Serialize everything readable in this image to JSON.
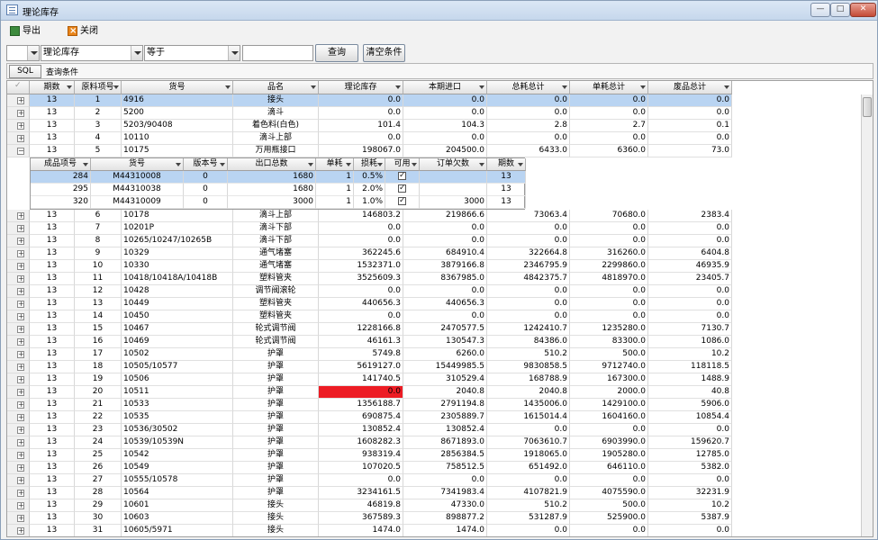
{
  "window": {
    "title": "理论库存",
    "min": "—",
    "max": "□",
    "close": "✕"
  },
  "toolbar": {
    "export": "导出",
    "close": "关闭"
  },
  "filter": {
    "field0": "",
    "field": "理论库存",
    "operator": "等于",
    "value": "",
    "query": "查询",
    "clear": "清空条件"
  },
  "sqlbar": {
    "sql": "SQL",
    "conditions": "查询条件"
  },
  "colors": {
    "negative": "#ed1c24",
    "selected": "#b9d4f2"
  },
  "grid": {
    "headers": [
      "期数",
      "原料项号",
      "货号",
      "品名",
      "理论库存",
      "本期进口",
      "总耗总计",
      "单耗总计",
      "废品总计"
    ],
    "rows": [
      {
        "exp": "+",
        "c": [
          "13",
          "1",
          "4916",
          "接头",
          "0.0",
          "0.0",
          "0.0",
          "0.0",
          "0.0"
        ]
      },
      {
        "exp": "+",
        "c": [
          "13",
          "2",
          "5200",
          "滴斗",
          "0.0",
          "0.0",
          "0.0",
          "0.0",
          "0.0"
        ]
      },
      {
        "exp": "+",
        "c": [
          "13",
          "3",
          "5203/90408",
          "着色料(白色)",
          "101.4",
          "104.3",
          "2.8",
          "2.7",
          "0.1"
        ]
      },
      {
        "exp": "+",
        "c": [
          "13",
          "4",
          "10110",
          "滴斗上部",
          "0.0",
          "0.0",
          "0.0",
          "0.0",
          "0.0"
        ]
      },
      {
        "exp": "−",
        "c": [
          "13",
          "5",
          "10175",
          "万用瓶接口",
          "198067.0",
          "204500.0",
          "6433.0",
          "6360.0",
          "73.0"
        ]
      },
      {
        "exp": "+",
        "c": [
          "13",
          "6",
          "10178",
          "滴斗上部",
          "146803.2",
          "219866.6",
          "73063.4",
          "70680.0",
          "2383.4"
        ]
      },
      {
        "exp": "+",
        "c": [
          "13",
          "7",
          "10201P",
          "滴斗下部",
          "0.0",
          "0.0",
          "0.0",
          "0.0",
          "0.0"
        ]
      },
      {
        "exp": "+",
        "c": [
          "13",
          "8",
          "10265/10247/10265B",
          "滴斗下部",
          "0.0",
          "0.0",
          "0.0",
          "0.0",
          "0.0"
        ]
      },
      {
        "exp": "+",
        "c": [
          "13",
          "9",
          "10329",
          "通气堵塞",
          "362245.6",
          "684910.4",
          "322664.8",
          "316260.0",
          "6404.8"
        ]
      },
      {
        "exp": "+",
        "c": [
          "13",
          "10",
          "10330",
          "通气堵塞",
          "1532371.0",
          "3879166.8",
          "2346795.9",
          "2299860.0",
          "46935.9"
        ]
      },
      {
        "exp": "+",
        "c": [
          "13",
          "11",
          "10418/10418A/10418B",
          "塑料管夹",
          "3525609.3",
          "8367985.0",
          "4842375.7",
          "4818970.0",
          "23405.7"
        ]
      },
      {
        "exp": "+",
        "c": [
          "13",
          "12",
          "10428",
          "调节阀滚轮",
          "0.0",
          "0.0",
          "0.0",
          "0.0",
          "0.0"
        ]
      },
      {
        "exp": "+",
        "c": [
          "13",
          "13",
          "10449",
          "塑料管夹",
          "440656.3",
          "440656.3",
          "0.0",
          "0.0",
          "0.0"
        ]
      },
      {
        "exp": "+",
        "c": [
          "13",
          "14",
          "10450",
          "塑料管夹",
          "0.0",
          "0.0",
          "0.0",
          "0.0",
          "0.0"
        ]
      },
      {
        "exp": "+",
        "c": [
          "13",
          "15",
          "10467",
          "轮式调节阀",
          "1228166.8",
          "2470577.5",
          "1242410.7",
          "1235280.0",
          "7130.7"
        ]
      },
      {
        "exp": "+",
        "c": [
          "13",
          "16",
          "10469",
          "轮式调节阀",
          "46161.3",
          "130547.3",
          "84386.0",
          "83300.0",
          "1086.0"
        ]
      },
      {
        "exp": "+",
        "c": [
          "13",
          "17",
          "10502",
          "护罩",
          "5749.8",
          "6260.0",
          "510.2",
          "500.0",
          "10.2"
        ]
      },
      {
        "exp": "+",
        "c": [
          "13",
          "18",
          "10505/10577",
          "护罩",
          "5619127.0",
          "15449985.5",
          "9830858.5",
          "9712740.0",
          "118118.5"
        ]
      },
      {
        "exp": "+",
        "c": [
          "13",
          "19",
          "10506",
          "护罩",
          "141740.5",
          "310529.4",
          "168788.9",
          "167300.0",
          "1488.9"
        ]
      },
      {
        "exp": "+",
        "c": [
          "13",
          "20",
          "10511",
          "护罩",
          "0.0",
          "2040.8",
          "2040.8",
          "2000.0",
          "40.8"
        ],
        "neg": true
      },
      {
        "exp": "+",
        "c": [
          "13",
          "21",
          "10533",
          "护罩",
          "1356188.7",
          "2791194.8",
          "1435006.0",
          "1429100.0",
          "5906.0"
        ]
      },
      {
        "exp": "+",
        "c": [
          "13",
          "22",
          "10535",
          "护罩",
          "690875.4",
          "2305889.7",
          "1615014.4",
          "1604160.0",
          "10854.4"
        ]
      },
      {
        "exp": "+",
        "c": [
          "13",
          "23",
          "10536/30502",
          "护罩",
          "130852.4",
          "130852.4",
          "0.0",
          "0.0",
          "0.0"
        ]
      },
      {
        "exp": "+",
        "c": [
          "13",
          "24",
          "10539/10539N",
          "护罩",
          "1608282.3",
          "8671893.0",
          "7063610.7",
          "6903990.0",
          "159620.7"
        ]
      },
      {
        "exp": "+",
        "c": [
          "13",
          "25",
          "10542",
          "护罩",
          "938319.4",
          "2856384.5",
          "1918065.0",
          "1905280.0",
          "12785.0"
        ]
      },
      {
        "exp": "+",
        "c": [
          "13",
          "26",
          "10549",
          "护罩",
          "107020.5",
          "758512.5",
          "651492.0",
          "646110.0",
          "5382.0"
        ]
      },
      {
        "exp": "+",
        "c": [
          "13",
          "27",
          "10555/10578",
          "护罩",
          "0.0",
          "0.0",
          "0.0",
          "0.0",
          "0.0"
        ]
      },
      {
        "exp": "+",
        "c": [
          "13",
          "28",
          "10564",
          "护罩",
          "3234161.5",
          "7341983.4",
          "4107821.9",
          "4075590.0",
          "32231.9"
        ]
      },
      {
        "exp": "+",
        "c": [
          "13",
          "29",
          "10601",
          "接头",
          "46819.8",
          "47330.0",
          "510.2",
          "500.0",
          "10.2"
        ]
      },
      {
        "exp": "+",
        "c": [
          "13",
          "30",
          "10603",
          "接头",
          "367589.3",
          "898877.2",
          "531287.9",
          "525900.0",
          "5387.9"
        ]
      },
      {
        "exp": "+",
        "c": [
          "13",
          "31",
          "10605/5971",
          "接头",
          "1474.0",
          "1474.0",
          "0.0",
          "0.0",
          "0.0"
        ]
      }
    ]
  },
  "detail": {
    "headers": [
      "成品项号",
      "货号",
      "版本号",
      "出口总数",
      "单耗",
      "损耗",
      "可用",
      "订单欠数",
      "期数"
    ],
    "rows": [
      {
        "c": [
          "284",
          "M44310008",
          "0",
          "1680",
          "1",
          "0.5%",
          "",
          "",
          "13"
        ]
      },
      {
        "c": [
          "295",
          "M44310038",
          "0",
          "1680",
          "1",
          "2.0%",
          "",
          "",
          "13"
        ]
      },
      {
        "c": [
          "320",
          "M44310009",
          "0",
          "3000",
          "1",
          "1.0%",
          "",
          "3000",
          "13"
        ]
      }
    ]
  }
}
